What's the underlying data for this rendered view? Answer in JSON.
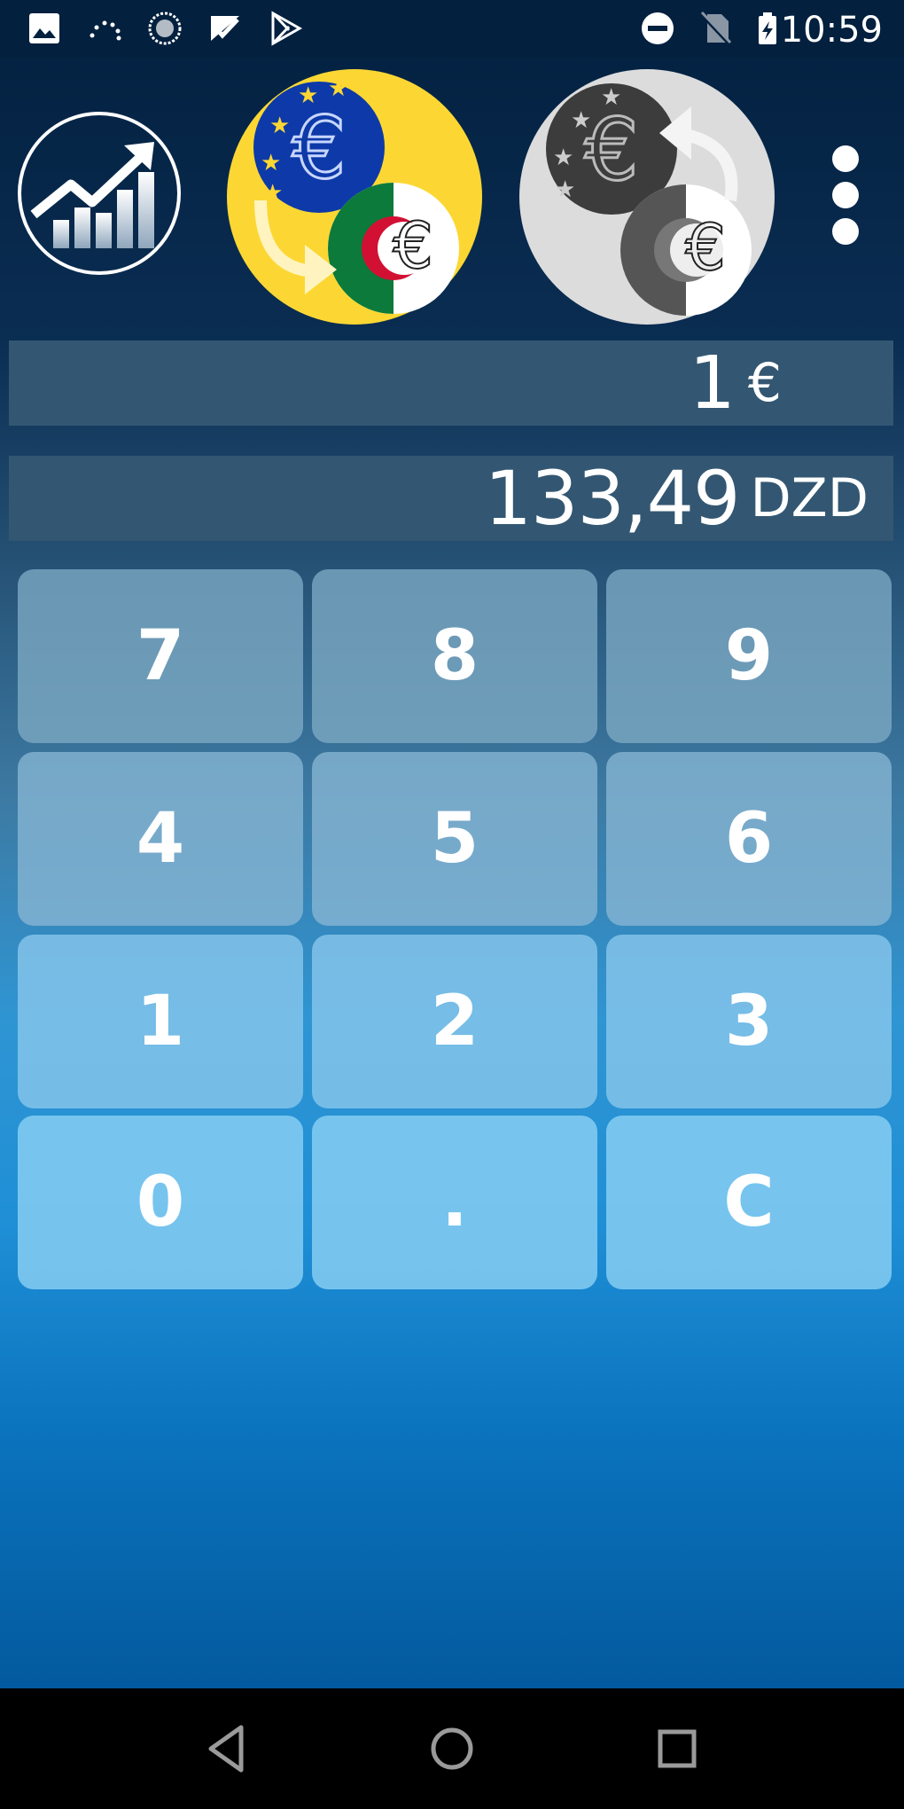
{
  "status_bar": {
    "time": "10:59",
    "left_icons": [
      "image-icon",
      "sync-dots-icon",
      "circle-progress-icon",
      "checkmark-icon",
      "play-store-icon"
    ],
    "right_icons": [
      "do-not-disturb-icon",
      "no-sim-icon",
      "battery-charging-icon"
    ]
  },
  "toolbar": {
    "chart_icon": "trending-chart-icon",
    "from_currency_icon": "euro-to-dinar-icon",
    "swap_icon": "swap-currencies-icon",
    "menu_icon": "more-vert-icon"
  },
  "display": {
    "from_value": "1",
    "from_symbol": "€",
    "to_value": "133,49",
    "to_code": "DZD"
  },
  "keypad": {
    "k7": "7",
    "k8": "8",
    "k9": "9",
    "k4": "4",
    "k5": "5",
    "k6": "6",
    "k1": "1",
    "k2": "2",
    "k3": "3",
    "k0": "0",
    "kdot": ".",
    "kc": "C"
  },
  "nav": [
    "back-icon",
    "home-icon",
    "recents-icon"
  ]
}
